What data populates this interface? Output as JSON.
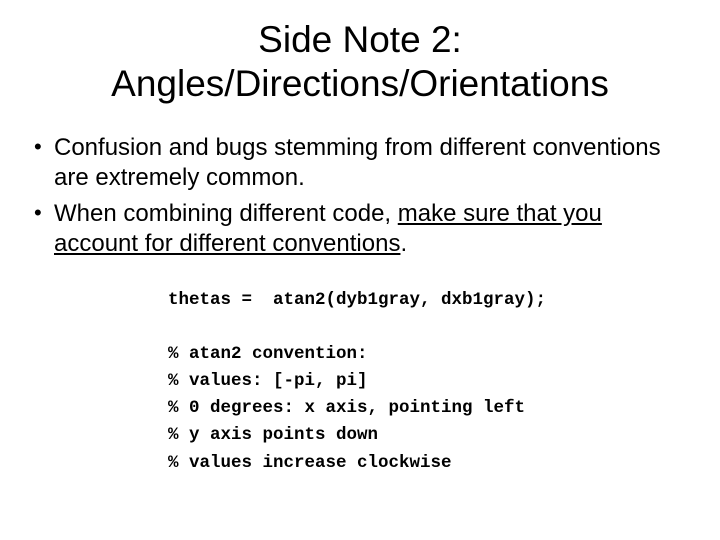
{
  "title": {
    "line1": "Side Note 2:",
    "line2": "Angles/Directions/Orientations"
  },
  "bullets": {
    "b1": "Confusion and bugs stemming from different conventions are extremely common.",
    "b2_a": "When combining different code, ",
    "b2_b": "make sure that you account for different conventions",
    "b2_c": "."
  },
  "code": {
    "l1": "thetas =  atan2(dyb1gray, dxb1gray);",
    "blank": "",
    "l2": "% atan2 convention:",
    "l3": "% values: [-pi, pi]",
    "l4": "% 0 degrees: x axis, pointing left",
    "l5": "% y axis points down",
    "l6": "% values increase clockwise"
  }
}
